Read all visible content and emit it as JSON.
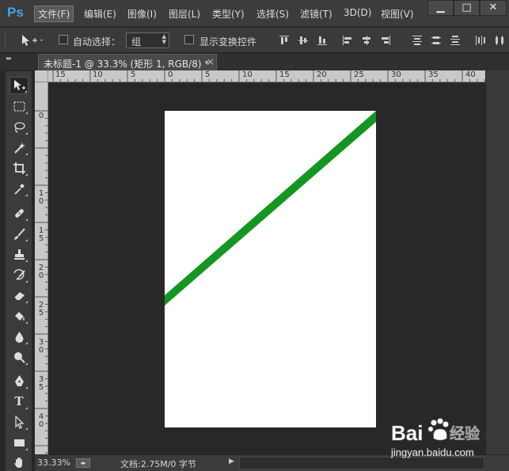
{
  "app": {
    "logo": "Ps",
    "menu": [
      {
        "label": "文件(F)",
        "active": true
      },
      {
        "label": "编辑(E)"
      },
      {
        "label": "图像(I)"
      },
      {
        "label": "图层(L)"
      },
      {
        "label": "类型(Y)"
      },
      {
        "label": "选择(S)"
      },
      {
        "label": "滤镜(T)"
      },
      {
        "label": "3D(D)"
      },
      {
        "label": "视图(V)"
      }
    ],
    "window_controls": {
      "minimize": "▁",
      "maximize": "□",
      "close": "✕"
    }
  },
  "options_bar": {
    "auto_select_label": "自动选择：",
    "auto_select_checked": false,
    "group_value": "组",
    "show_transform_label": "显示变换控件",
    "show_transform_checked": false
  },
  "document_tab": {
    "title": "未标题-1 @ 33.3% (矩形 1, RGB/8) *",
    "close": "×"
  },
  "rulers": {
    "top_labels": [
      "15",
      "10",
      "5",
      "0",
      "5",
      "10",
      "15",
      "20",
      "25",
      "30",
      "35",
      "40"
    ],
    "left_labels": [
      "0",
      "1\n0",
      "1\n5",
      "2\n0",
      "2\n5",
      "3\n0",
      "3\n5",
      "4\n0"
    ]
  },
  "canvas": {
    "background": "#ffffff",
    "shape": {
      "type": "diagonal-stripe",
      "color": "#149623"
    }
  },
  "status_bar": {
    "zoom": "33.33%",
    "doc_info": "文档:2.75M/0 字节",
    "arrow": "▶"
  },
  "watermark": {
    "brand": "Bai",
    "brand_suffix": "经验",
    "url": "jingyan.baidu.com"
  },
  "tools": [
    {
      "name": "move-tool-icon",
      "selected": true
    },
    {
      "name": "marquee-tool-icon"
    },
    {
      "name": "lasso-tool-icon"
    },
    {
      "name": "magic-wand-tool-icon"
    },
    {
      "name": "crop-tool-icon"
    },
    {
      "name": "eyedropper-tool-icon"
    },
    {
      "name": "healing-brush-tool-icon"
    },
    {
      "name": "brush-tool-icon"
    },
    {
      "name": "clone-stamp-tool-icon"
    },
    {
      "name": "history-brush-tool-icon"
    },
    {
      "name": "eraser-tool-icon"
    },
    {
      "name": "paint-bucket-tool-icon"
    },
    {
      "name": "blur-tool-icon"
    },
    {
      "name": "dodge-tool-icon"
    },
    {
      "name": "pen-tool-icon"
    },
    {
      "name": "type-tool-icon",
      "glyph": "T"
    },
    {
      "name": "path-selection-tool-icon"
    },
    {
      "name": "rectangle-tool-icon"
    },
    {
      "name": "hand-tool-icon"
    }
  ]
}
